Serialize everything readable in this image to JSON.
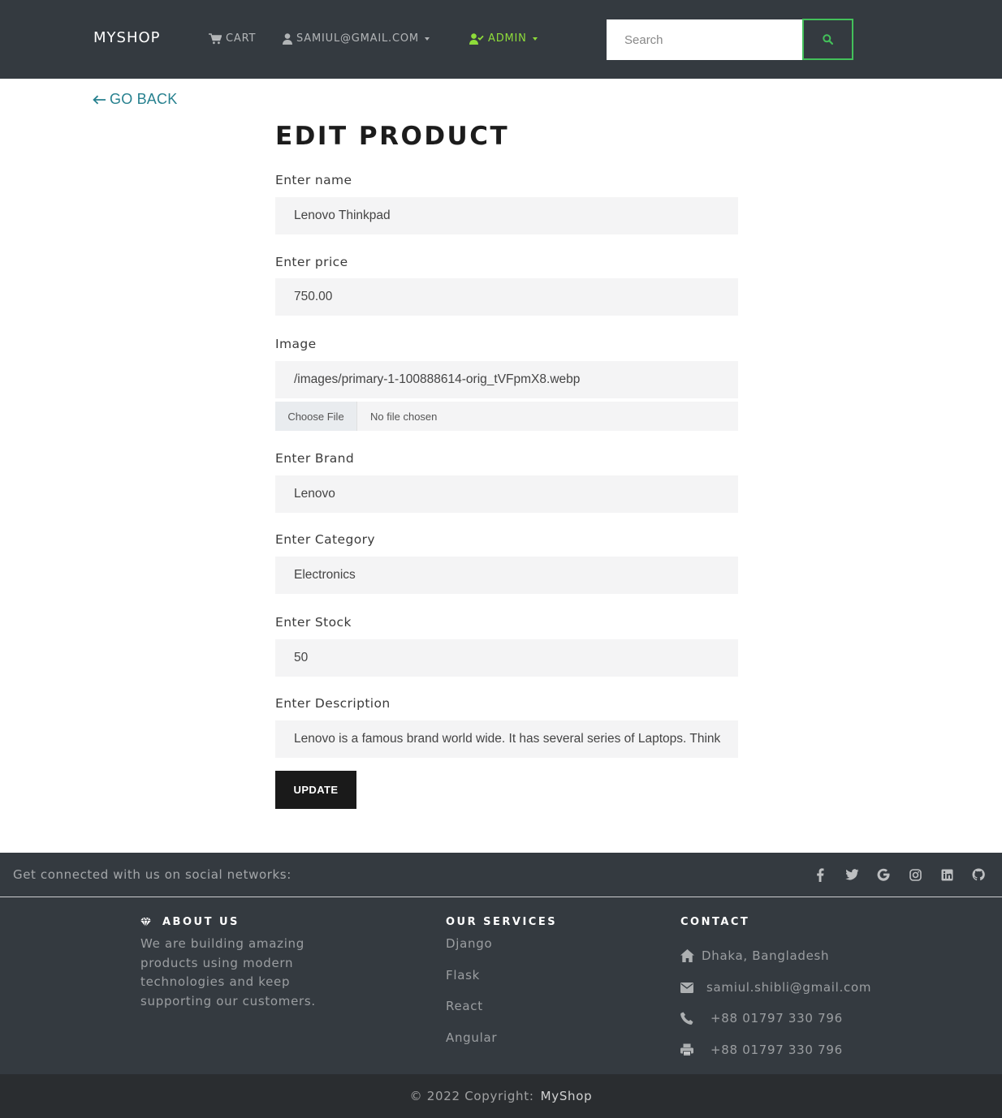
{
  "navbar": {
    "brand": "MYSHOP",
    "cart": "CART",
    "user": "SAMIUL@GMAIL.COM",
    "admin": "ADMIN",
    "search_placeholder": "Search"
  },
  "go_back": "GO BACK",
  "form": {
    "title": "EDIT PRODUCT",
    "fields": {
      "name": {
        "label": "Enter name",
        "value": "Lenovo Thinkpad"
      },
      "price": {
        "label": "Enter price",
        "value": "750.00"
      },
      "image": {
        "label": "Image",
        "value": "/images/primary-1-100888614-orig_tVFpmX8.webp"
      },
      "brand": {
        "label": "Enter Brand",
        "value": "Lenovo"
      },
      "category": {
        "label": "Enter Category",
        "value": "Electronics"
      },
      "stock": {
        "label": "Enter Stock",
        "value": "50"
      },
      "description": {
        "label": "Enter Description",
        "value": "Lenovo is a famous brand world wide. It has several series of Laptops. Think"
      }
    },
    "file": {
      "button": "Choose File",
      "status": "No file chosen"
    },
    "submit": "UPDATE"
  },
  "footer": {
    "social_text": "Get connected with us on social networks:",
    "social_icons": [
      "facebook-icon",
      "twitter-icon",
      "google-icon",
      "instagram-icon",
      "linkedin-icon",
      "github-icon"
    ],
    "about": {
      "heading": "ABOUT US",
      "text": "We are building amazing products using modern technologies and keep supporting our customers."
    },
    "services": {
      "heading": "OUR SERVICES",
      "items": [
        "Django",
        "Flask",
        "React",
        "Angular"
      ]
    },
    "contact": {
      "heading": "CONTACT",
      "address": "Dhaka, Bangladesh",
      "email": "samiul.shibli@gmail.com",
      "phone": "+88 01797 330 796",
      "fax": "+88 01797 330 796"
    },
    "copyright": "© 2022 Copyright:",
    "copyright_brand": "MyShop"
  },
  "colors": {
    "navbar_bg": "#343a40",
    "admin_accent": "#8edc3a",
    "search_button_border": "#43c05a",
    "link_teal": "#27818f",
    "copyright_bg": "#2a2d30"
  }
}
